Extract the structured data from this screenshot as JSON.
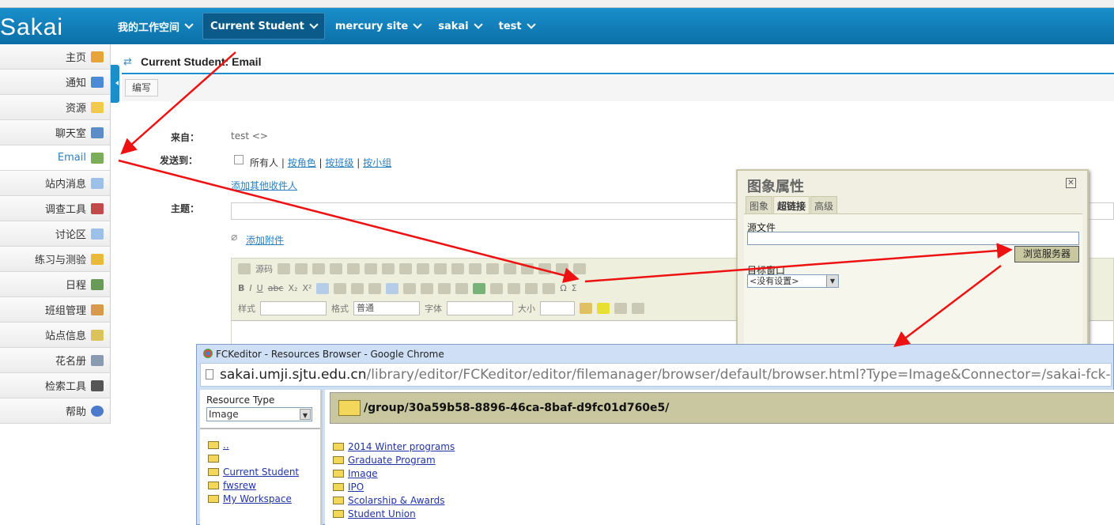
{
  "header": {
    "logo": "Sakai",
    "nav": [
      "我的工作空间",
      "Current Student",
      "mercury site",
      "sakai",
      "test"
    ],
    "active_nav": "Current Student"
  },
  "sidebar": {
    "items": [
      {
        "label": "主页",
        "icon": "home-icon"
      },
      {
        "label": "通知",
        "icon": "announcement-icon"
      },
      {
        "label": "资源",
        "icon": "folder-icon"
      },
      {
        "label": "聊天室",
        "icon": "chat-icon"
      },
      {
        "label": "Email",
        "icon": "email-icon"
      },
      {
        "label": "站内消息",
        "icon": "message-icon"
      },
      {
        "label": "调查工具",
        "icon": "chart-icon"
      },
      {
        "label": "讨论区",
        "icon": "forum-icon"
      },
      {
        "label": "练习与测验",
        "icon": "pencil-icon"
      },
      {
        "label": "日程",
        "icon": "calendar-icon"
      },
      {
        "label": "班组管理",
        "icon": "group-icon"
      },
      {
        "label": "站点信息",
        "icon": "site-info-icon"
      },
      {
        "label": "花名册",
        "icon": "roster-icon"
      },
      {
        "label": "检索工具",
        "icon": "search-tool-icon"
      },
      {
        "label": "帮助",
        "icon": "help-icon"
      }
    ],
    "active": "Email"
  },
  "page": {
    "title": "Current Student: Email",
    "compose_button": "编写",
    "from_label": "来自：",
    "from_value": "test <>",
    "to_label": "发送到：",
    "everyone": "所有人",
    "by_role": "按角色",
    "by_section": "按班级",
    "by_group": "按小组",
    "add_recipients": "添加其他收件人",
    "subject_label": "主题：",
    "add_attachment": "添加附件"
  },
  "editor": {
    "source": "源码",
    "style_label": "样式",
    "format_label": "格式",
    "format_value": "普通",
    "font_label": "字体",
    "size_label": "大小"
  },
  "image_dialog": {
    "title": "图象属性",
    "tabs": [
      "图象",
      "超链接",
      "高级"
    ],
    "active_tab": "超链接",
    "source_label": "源文件",
    "browse_button": "浏览服务器",
    "target_label": "目标窗口",
    "target_value": "<没有设置>"
  },
  "browser": {
    "window_title": "FCKeditor - Resources Browser - Google Chrome",
    "url_host": "sakai.umji.sjtu.edu.cn",
    "url_path": "/library/editor/FCKeditor/editor/filemanager/browser/default/browser.html?Type=Image&Connector=/sakai-fck-connector/we",
    "resource_type_label": "Resource Type",
    "resource_type_value": "Image",
    "current_path": "/group/30a59b58-8896-46ca-8baf-d9fc01d760e5/",
    "tree": [
      "..",
      "",
      "Current Student",
      "fwsrew",
      "My Workspace"
    ],
    "folders": [
      "2014 Winter programs",
      "Graduate Program",
      "Image",
      "IPO",
      "Scolarship & Awards",
      "Student Union"
    ]
  },
  "colors": {
    "header": "#0f7db8",
    "accent": "#1a8fcc",
    "annotation_arrow": "#ee1111"
  }
}
